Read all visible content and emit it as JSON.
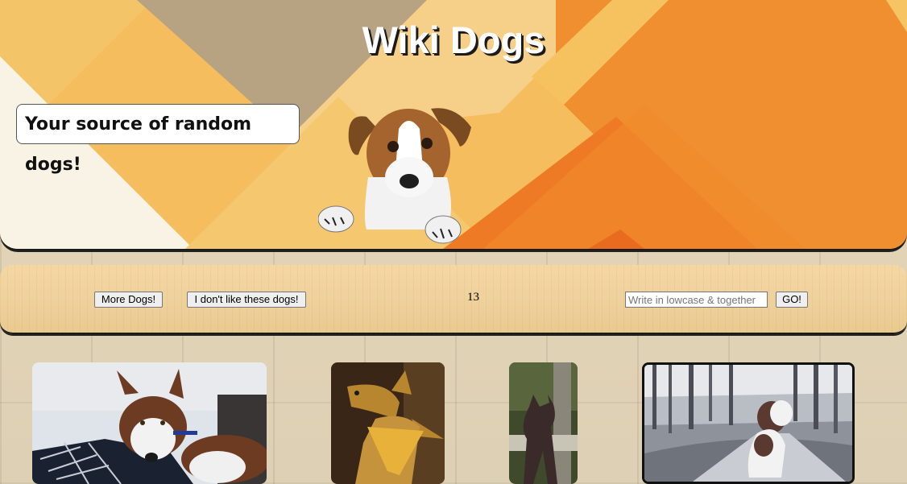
{
  "header": {
    "title": "Wiki Dogs",
    "tagline": "Your source of random dogs!"
  },
  "controls": {
    "more_label": "More Dogs!",
    "dislike_label": "I don't like these dogs!",
    "count": "13",
    "search_placeholder": "Write in lowcase & together",
    "search_value": "",
    "go_label": "GO!"
  },
  "gallery": {
    "images": [
      {
        "name": "husky-photo",
        "icon": "dog-photo"
      },
      {
        "name": "greyhound-photo",
        "icon": "dog-photo"
      },
      {
        "name": "dark-dog-photo",
        "icon": "dog-photo"
      },
      {
        "name": "spaniel-photo",
        "icon": "dog-photo"
      }
    ]
  },
  "colors": {
    "banner_orange": "#f08a2e",
    "banner_tan": "#b7a484",
    "banner_yellow": "#f5c062",
    "bar_wood": "#eed09b",
    "page_wood": "#e3d3b6"
  }
}
